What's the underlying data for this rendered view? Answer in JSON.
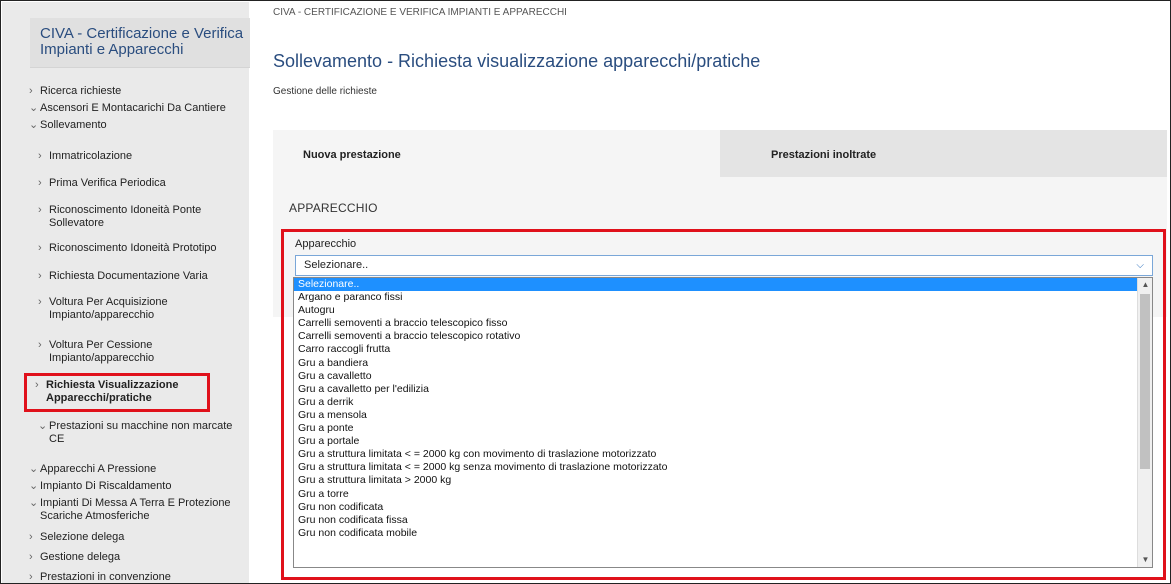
{
  "sidebar": {
    "title": "CIVA - Certificazione e Verifica Impianti e Apparecchi",
    "items": [
      {
        "chev": "›",
        "label": "Ricerca richieste"
      },
      {
        "chev": "⌄",
        "label": "Ascensori E Montacarichi Da Cantiere"
      },
      {
        "chev": "⌄",
        "label": "Sollevamento"
      },
      {
        "chev": "›",
        "label": "Immatricolazione"
      },
      {
        "chev": "›",
        "label": "Prima Verifica Periodica"
      },
      {
        "chev": "›",
        "label": "Riconoscimento Idoneità Ponte Sollevatore"
      },
      {
        "chev": "›",
        "label": "Riconoscimento Idoneità Prototipo"
      },
      {
        "chev": "›",
        "label": "Richiesta Documentazione Varia"
      },
      {
        "chev": "›",
        "label": "Voltura Per Acquisizione Impianto/apparecchio"
      },
      {
        "chev": "›",
        "label": "Voltura Per Cessione Impianto/apparecchio"
      },
      {
        "chev": "›",
        "label": "Richiesta Visualizzazione Apparecchi/pratiche"
      },
      {
        "chev": "⌄",
        "label": "Prestazioni su macchine non marcate CE"
      },
      {
        "chev": "⌄",
        "label": "Apparecchi A Pressione"
      },
      {
        "chev": "⌄",
        "label": "Impianto Di Riscaldamento"
      },
      {
        "chev": "⌄",
        "label": "Impianti Di Messa A Terra E Protezione Scariche Atmosferiche"
      },
      {
        "chev": "›",
        "label": "Selezione delega"
      },
      {
        "chev": "›",
        "label": "Gestione delega"
      },
      {
        "chev": "›",
        "label": "Prestazioni in convenzione"
      }
    ]
  },
  "main": {
    "breadcrumb": "CIVA - CERTIFICAZIONE E VERIFICA IMPIANTI E APPARECCHI",
    "title": "Sollevamento - Richiesta visualizzazione apparecchi/pratiche",
    "subtitle": "Gestione delle richieste",
    "tabs": [
      {
        "label": "Nuova prestazione"
      },
      {
        "label": "Prestazioni inoltrate"
      }
    ],
    "section_heading": "APPARECCHIO",
    "field_label": "Apparecchio",
    "select_value": "Selezionare..",
    "options": [
      "Selezionare..",
      "Argano e paranco fissi",
      "Autogru",
      "Carrelli semoventi a braccio telescopico fisso",
      "Carrelli semoventi a braccio telescopico rotativo",
      "Carro raccogli frutta",
      "Gru a bandiera",
      "Gru a cavalletto",
      "Gru a cavalletto per l'edilizia",
      "Gru a derrik",
      "Gru a mensola",
      "Gru a ponte",
      "Gru a portale",
      "Gru a struttura limitata < = 2000 kg con movimento di traslazione motorizzato",
      "Gru a struttura limitata < = 2000 kg senza movimento di traslazione motorizzato",
      "Gru a struttura limitata > 2000 kg",
      "Gru a torre",
      "Gru non codificata",
      "Gru non codificata fissa",
      "Gru non codificata mobile"
    ]
  },
  "colors": {
    "accent": "#2a4d7f",
    "highlight": "#e0111b",
    "selected_option": "#1e90ff"
  }
}
